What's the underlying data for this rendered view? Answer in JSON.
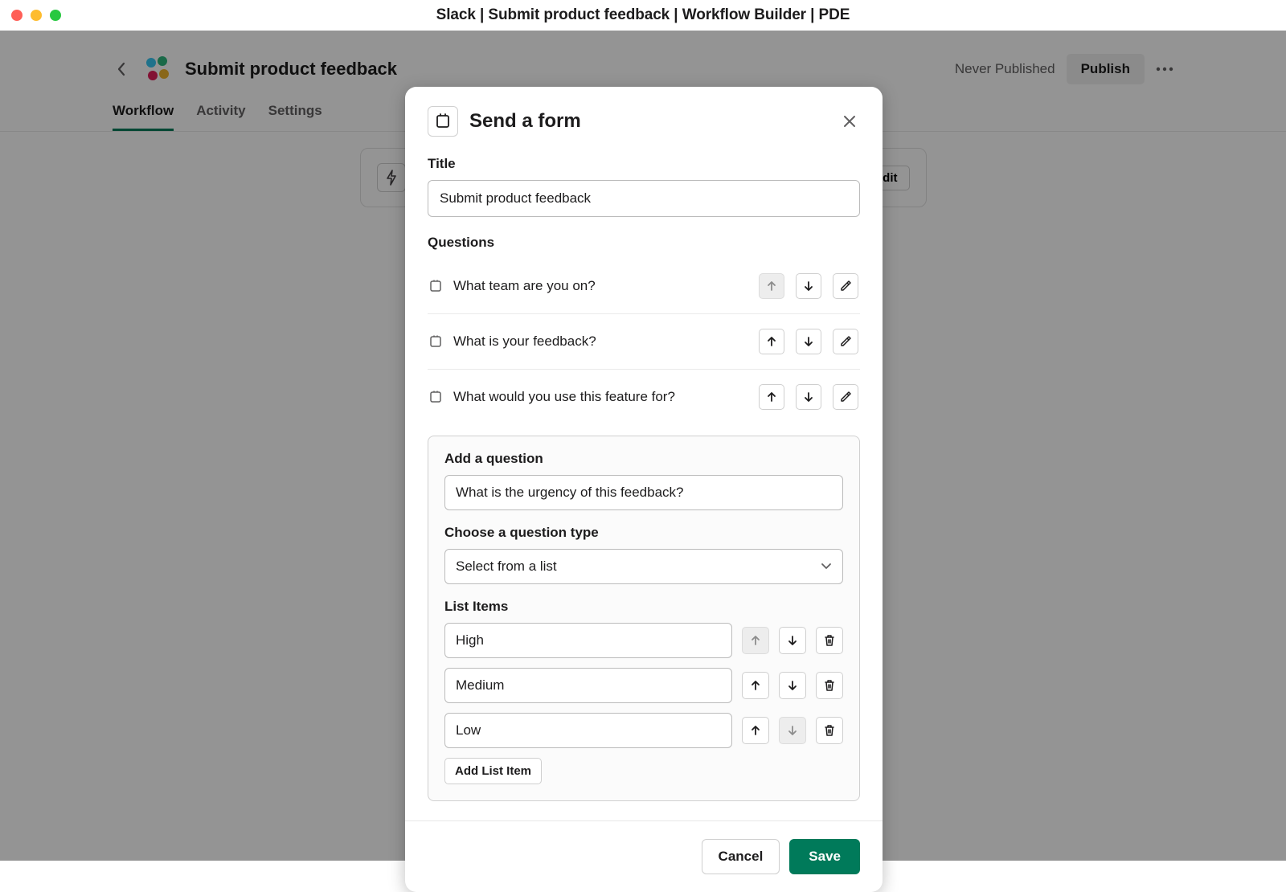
{
  "window": {
    "title": "Slack | Submit product feedback | Workflow Builder | PDE"
  },
  "header": {
    "page_title": "Submit product feedback",
    "never_published": "Never Published",
    "publish": "Publish"
  },
  "tabs": {
    "workflow": "Workflow",
    "activity": "Activity",
    "settings": "Settings"
  },
  "step_card": {
    "edit": "Edit"
  },
  "modal": {
    "title": "Send a form",
    "title_label": "Title",
    "title_value": "Submit product feedback",
    "questions_label": "Questions",
    "questions": [
      {
        "text": "What team are you on?"
      },
      {
        "text": "What is your feedback?"
      },
      {
        "text": "What would you use this feature for?"
      }
    ],
    "add_question_label": "Add a question",
    "add_question_value": "What is the urgency of this feedback?",
    "choose_type_label": "Choose a question type",
    "choose_type_value": "Select from a list",
    "list_items_label": "List Items",
    "list_items": [
      {
        "value": "High"
      },
      {
        "value": "Medium"
      },
      {
        "value": "Low"
      }
    ],
    "add_list_item": "Add List Item",
    "cancel": "Cancel",
    "save": "Save"
  }
}
